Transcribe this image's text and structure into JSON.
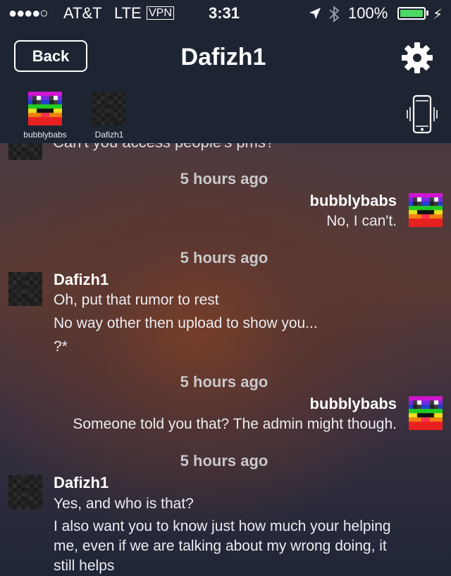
{
  "status_bar": {
    "signal": "●●●●○",
    "carrier": "AT&T",
    "network": "LTE",
    "vpn": "VPN",
    "time": "3:31",
    "battery_percent": "100%",
    "battery_level": 1.0,
    "charging_icon": "bolt-icon"
  },
  "nav": {
    "back_label": "Back",
    "title": "Dafizh1",
    "settings_icon": "gear-icon"
  },
  "participants": [
    {
      "name": "bubblybabs",
      "avatar": "rainbow-avatar"
    },
    {
      "name": "Dafizh1",
      "avatar": "dark-avatar"
    }
  ],
  "vibrate_icon": "phone-vibrate-icon",
  "messages": {
    "cutoff_text": "Can't you access people's pms?",
    "m1": {
      "timestamp": "5 hours ago",
      "sender": "bubblybabs",
      "lines": [
        "No, I can't."
      ]
    },
    "m2": {
      "timestamp": "5 hours ago",
      "sender": "Dafizh1",
      "lines": [
        "Oh, put that rumor to rest",
        "No way other then upload to show you...",
        "?*"
      ]
    },
    "m3": {
      "timestamp": "5 hours ago",
      "sender": "bubblybabs",
      "lines": [
        "Someone told you that?  The admin might though."
      ]
    },
    "m4": {
      "timestamp": "5 hours ago",
      "sender": "Dafizh1",
      "lines": [
        "Yes, and who is that?",
        "I also want you to know just how much your helping",
        "me, even if we are talking about my wrong doing, it",
        "still helps"
      ]
    }
  },
  "colors": {
    "header_bg": "#1e2532",
    "battery_green": "#4cd964",
    "timestamp": "#c8c8cc"
  }
}
